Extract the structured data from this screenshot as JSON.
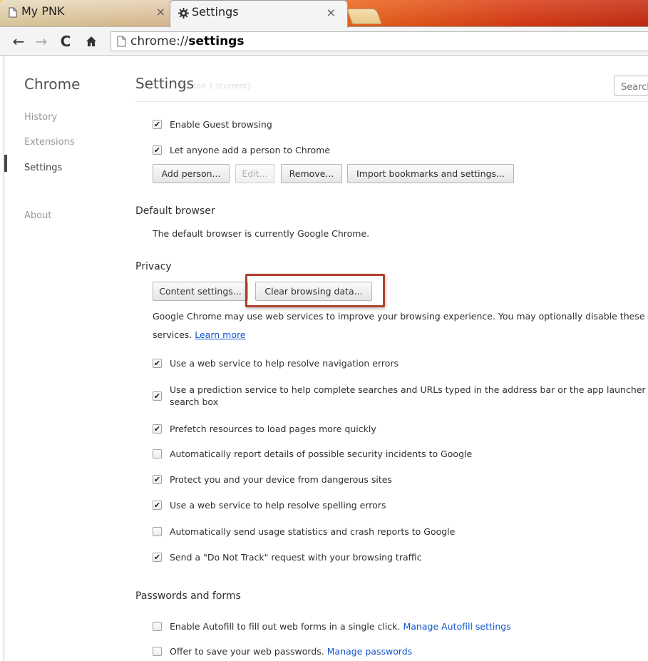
{
  "tabs": [
    {
      "title": "My PNK",
      "close": "×",
      "icon": "page-icon"
    },
    {
      "title": "Settings",
      "close": "×",
      "icon": "gear-icon"
    }
  ],
  "toolbar": {
    "back": "←",
    "forward": "→",
    "reload": "C",
    "home": "🏠",
    "url_scheme": "chrome://",
    "url_host": "settings"
  },
  "sidebar": {
    "title": "Chrome",
    "items": [
      {
        "label": "History"
      },
      {
        "label": "Extensions"
      },
      {
        "label": "Settings"
      },
      {
        "label": "About"
      }
    ]
  },
  "main": {
    "title": "Settings",
    "ghost_text": "Person 1 (current)",
    "search_placeholder": "Search",
    "people": {
      "guest": {
        "label": "Enable Guest browsing",
        "checked": true
      },
      "anyone": {
        "label": "Let anyone add a person to Chrome",
        "checked": true
      },
      "buttons": {
        "add": "Add person...",
        "edit": "Edit...",
        "remove": "Remove...",
        "import": "Import bookmarks and settings..."
      }
    },
    "default_browser": {
      "title": "Default browser",
      "text": "The default browser is currently Google Chrome."
    },
    "privacy": {
      "title": "Privacy",
      "content_settings": "Content settings...",
      "clear_browsing": "Clear browsing data...",
      "desc_line1": "Google Chrome may use web services to improve your browsing experience. You may optionally disable these",
      "desc_line2": "services.",
      "learn_more": "Learn more",
      "options": [
        {
          "label": "Use a web service to help resolve navigation errors",
          "checked": true
        },
        {
          "label": "Use a prediction service to help complete searches and URLs typed in the address bar or the app launcher search box",
          "checked": true
        },
        {
          "label": "Prefetch resources to load pages more quickly",
          "checked": true
        },
        {
          "label": "Automatically report details of possible security incidents to Google",
          "checked": false
        },
        {
          "label": "Protect you and your device from dangerous sites",
          "checked": true
        },
        {
          "label": "Use a web service to help resolve spelling errors",
          "checked": true
        },
        {
          "label": "Automatically send usage statistics and crash reports to Google",
          "checked": false
        },
        {
          "label": "Send a \"Do Not Track\" request with your browsing traffic",
          "checked": true
        }
      ]
    },
    "passwords": {
      "title": "Passwords and forms",
      "autofill": {
        "label": "Enable Autofill to fill out web forms in a single click.",
        "link": "Manage Autofill settings",
        "checked": false
      },
      "save": {
        "label": "Offer to save your web passwords.",
        "link": "Manage passwords",
        "checked": false
      }
    },
    "check_glyph": "✔"
  }
}
